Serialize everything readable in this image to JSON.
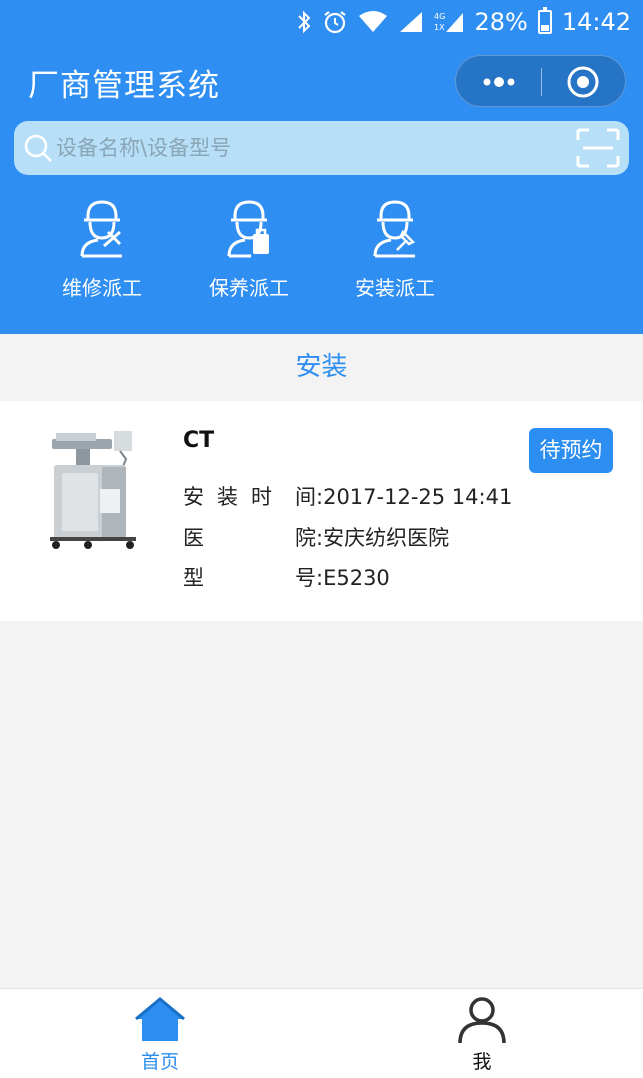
{
  "status_bar": {
    "battery": "28%",
    "time": "14:42",
    "network": "4G"
  },
  "header": {
    "title": "厂商管理系统"
  },
  "search": {
    "placeholder": "设备名称\\设备型号"
  },
  "quick_actions": [
    {
      "label": "维修派工",
      "icon": "repair-engineer-icon"
    },
    {
      "label": "保养派工",
      "icon": "maintenance-engineer-icon"
    },
    {
      "label": "安装派工",
      "icon": "install-engineer-icon"
    }
  ],
  "section": {
    "title": "安装"
  },
  "item": {
    "name": "CT",
    "status": "待预约",
    "fields": [
      {
        "key": "安装时",
        "sep": "间:",
        "value": "2017-12-25 14:41"
      },
      {
        "key": "医",
        "sep": "院:",
        "value": "安庆纺织医院"
      },
      {
        "key": "型",
        "sep": "号:",
        "value": "E5230"
      }
    ]
  },
  "tabs": [
    {
      "label": "首页",
      "active": true,
      "icon": "home-icon"
    },
    {
      "label": "我",
      "active": false,
      "icon": "user-icon"
    }
  ],
  "colors": {
    "primary": "#2f8ef1",
    "search_bg": "#b7e0f8"
  }
}
